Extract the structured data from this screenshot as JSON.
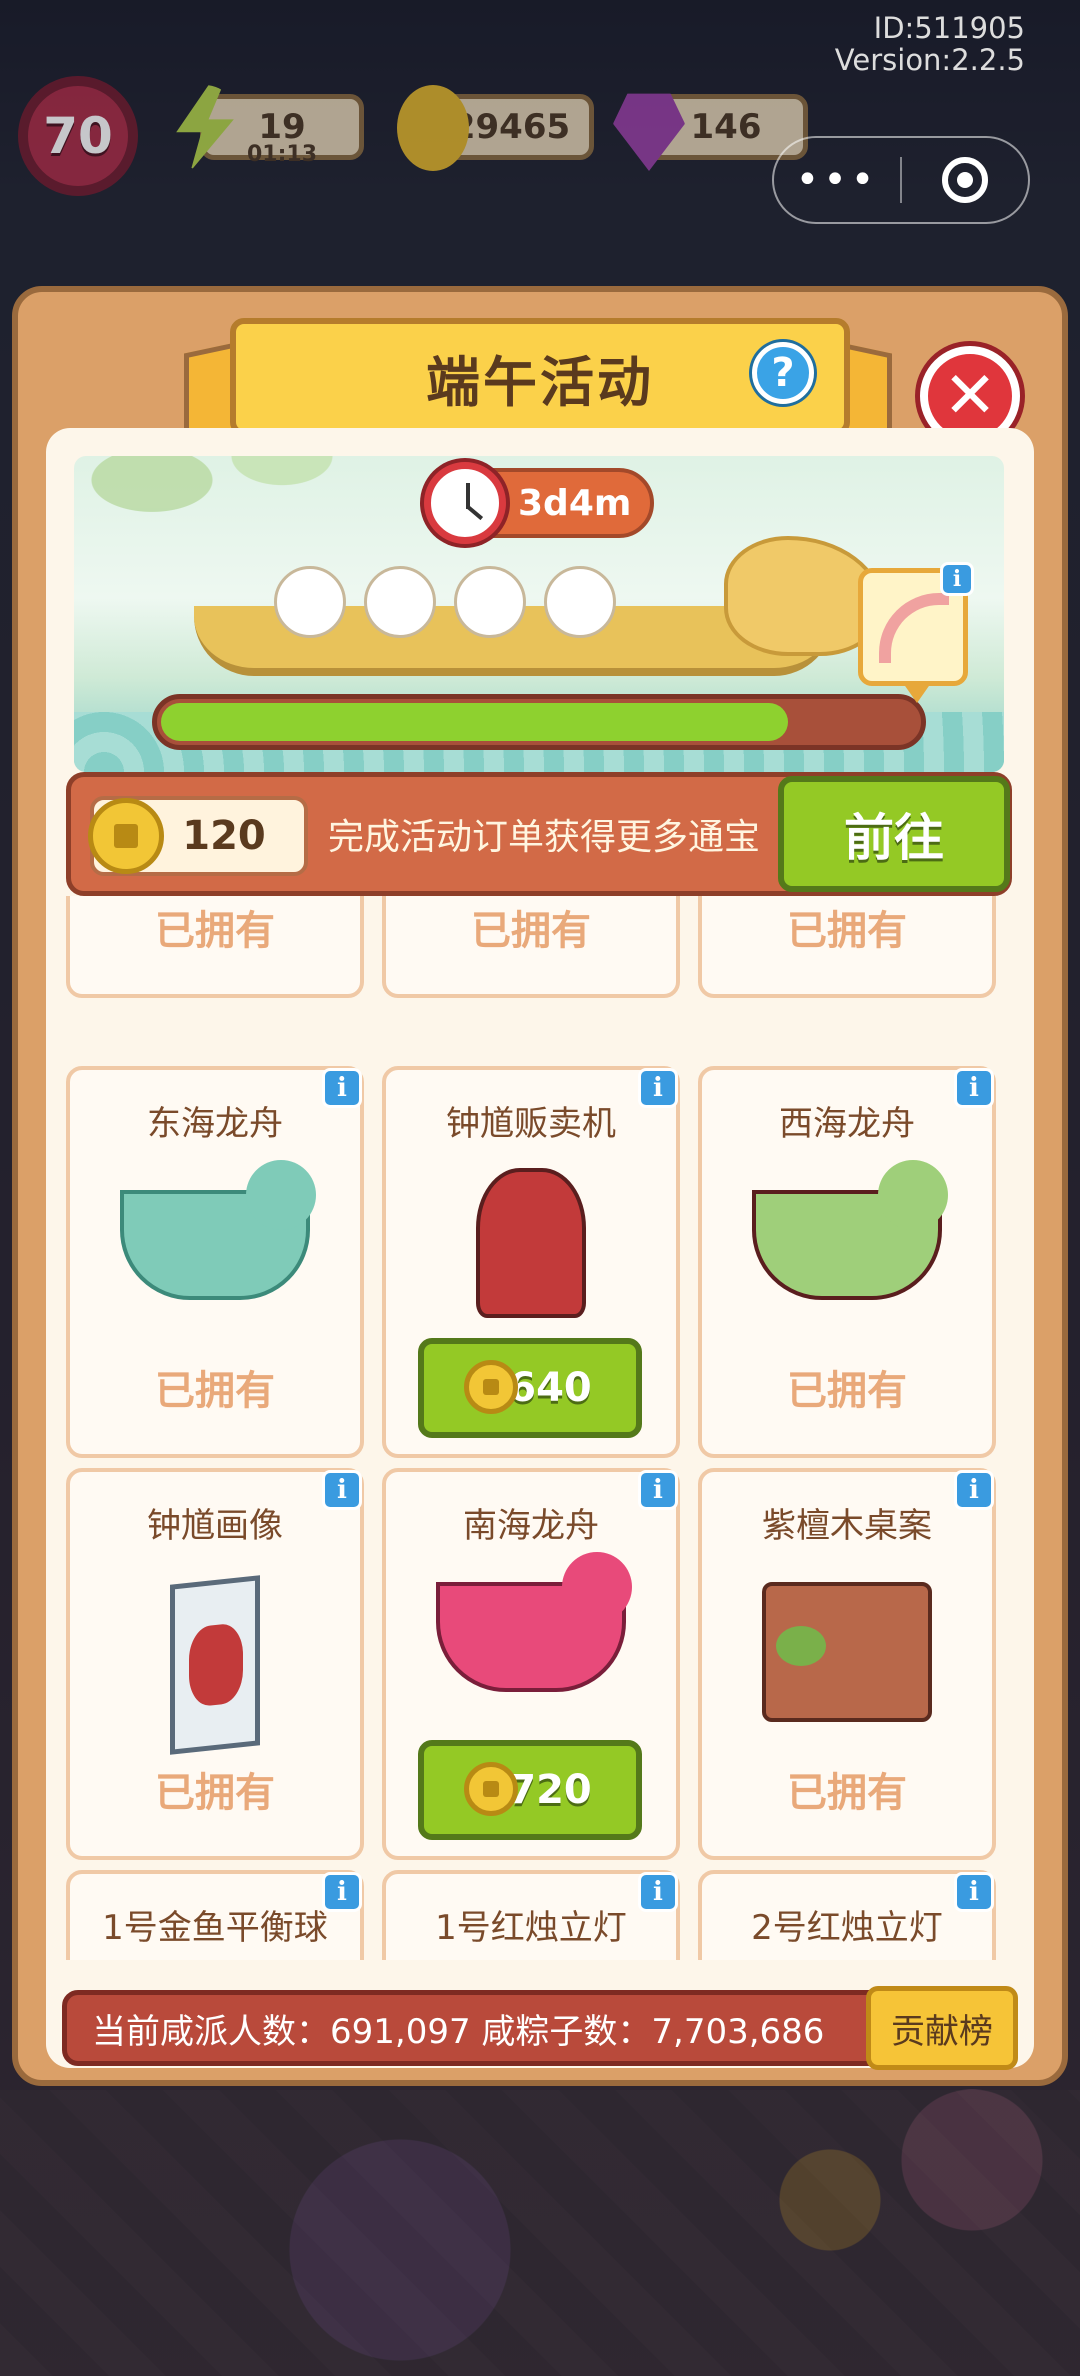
{
  "hud": {
    "id_text": "ID:511905",
    "version_text": "Version:2.2.5",
    "level": "70",
    "energy": "19",
    "energy_timer": "01:13",
    "coins": "29465",
    "gems": "146"
  },
  "dialog": {
    "title": "端午活动",
    "help_glyph": "?",
    "close_glyph": "✕",
    "timer": "3d4m",
    "progress_fraction": 0.83,
    "coin_balance": "120",
    "hint": "完成活动订单获得更多通宝",
    "go_label": "前往"
  },
  "items": [
    {
      "name": "",
      "status": "已拥有"
    },
    {
      "name": "",
      "status": "已拥有"
    },
    {
      "name": "",
      "status": "已拥有"
    },
    {
      "name": "东海龙舟",
      "status": "已拥有"
    },
    {
      "name": "钟馗贩卖机",
      "price": "640"
    },
    {
      "name": "西海龙舟",
      "status": "已拥有"
    },
    {
      "name": "钟馗画像",
      "status": "已拥有"
    },
    {
      "name": "南海龙舟",
      "price": "720"
    },
    {
      "name": "紫檀木桌案",
      "status": "已拥有"
    },
    {
      "name": "1号金鱼平衡球"
    },
    {
      "name": "1号红烛立灯"
    },
    {
      "name": "2号红烛立灯"
    }
  ],
  "info_glyph": "i",
  "stats": {
    "text": "当前咸派人数：691,097   咸粽子数：7,703,686",
    "rank_label": "贡献榜"
  },
  "colors": {
    "panel": "#dba068",
    "title": "#fbd14a",
    "green_button": "#94c925",
    "owned_text": "#e9a97a"
  }
}
